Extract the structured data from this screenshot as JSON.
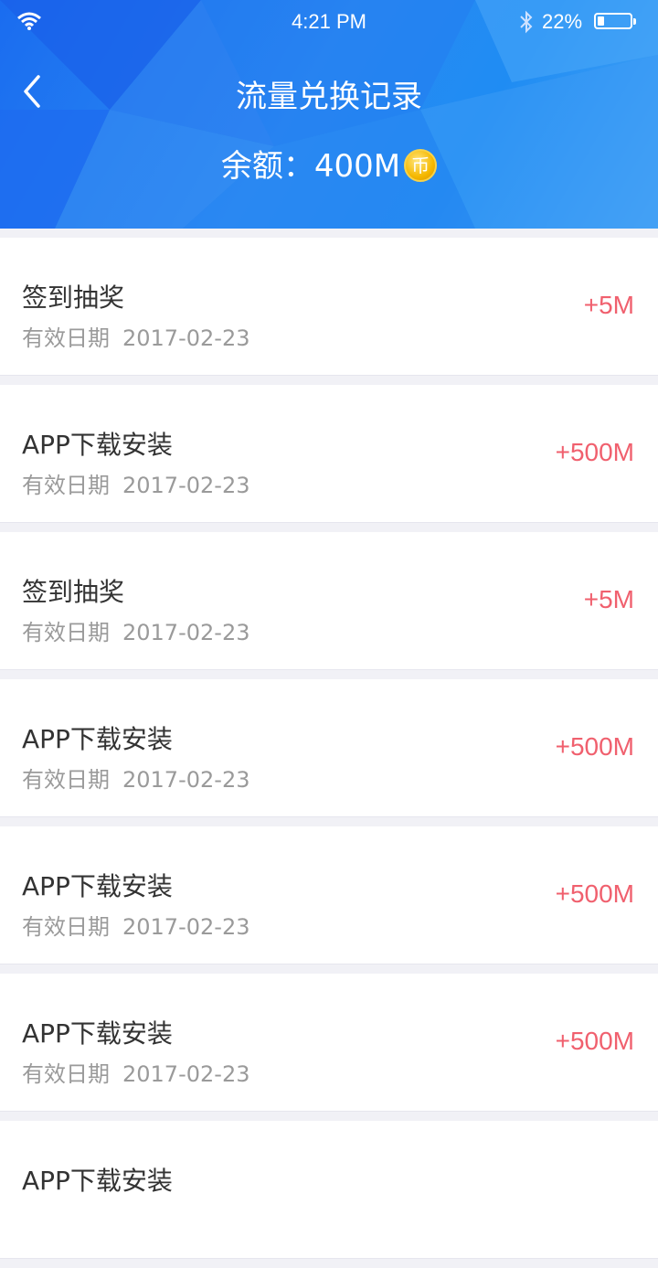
{
  "status_bar": {
    "time": "4:21 PM",
    "battery_percent": "22%",
    "battery_level": 0.22
  },
  "header": {
    "title": "流量兑换记录",
    "balance_text": "余额：400M",
    "coin_label": "币",
    "accent_color": "#1f8cf3"
  },
  "records": [
    {
      "name": "签到抽奖",
      "date_label": "有效日期",
      "date": "2017-02-23",
      "amount": "+5M"
    },
    {
      "name": "APP下载安装",
      "date_label": "有效日期",
      "date": "2017-02-23",
      "amount": "+500M"
    },
    {
      "name": "签到抽奖",
      "date_label": "有效日期",
      "date": "2017-02-23",
      "amount": "+5M"
    },
    {
      "name": "APP下载安装",
      "date_label": "有效日期",
      "date": "2017-02-23",
      "amount": "+500M"
    },
    {
      "name": "APP下载安装",
      "date_label": "有效日期",
      "date": "2017-02-23",
      "amount": "+500M"
    },
    {
      "name": "APP下载安装",
      "date_label": "有效日期",
      "date": "2017-02-23",
      "amount": "+500M"
    },
    {
      "name": "APP下载安装",
      "date_label": "",
      "date": "",
      "amount": ""
    }
  ],
  "colors": {
    "amount": "#f0606e",
    "page_bg": "#f1f1f6"
  }
}
